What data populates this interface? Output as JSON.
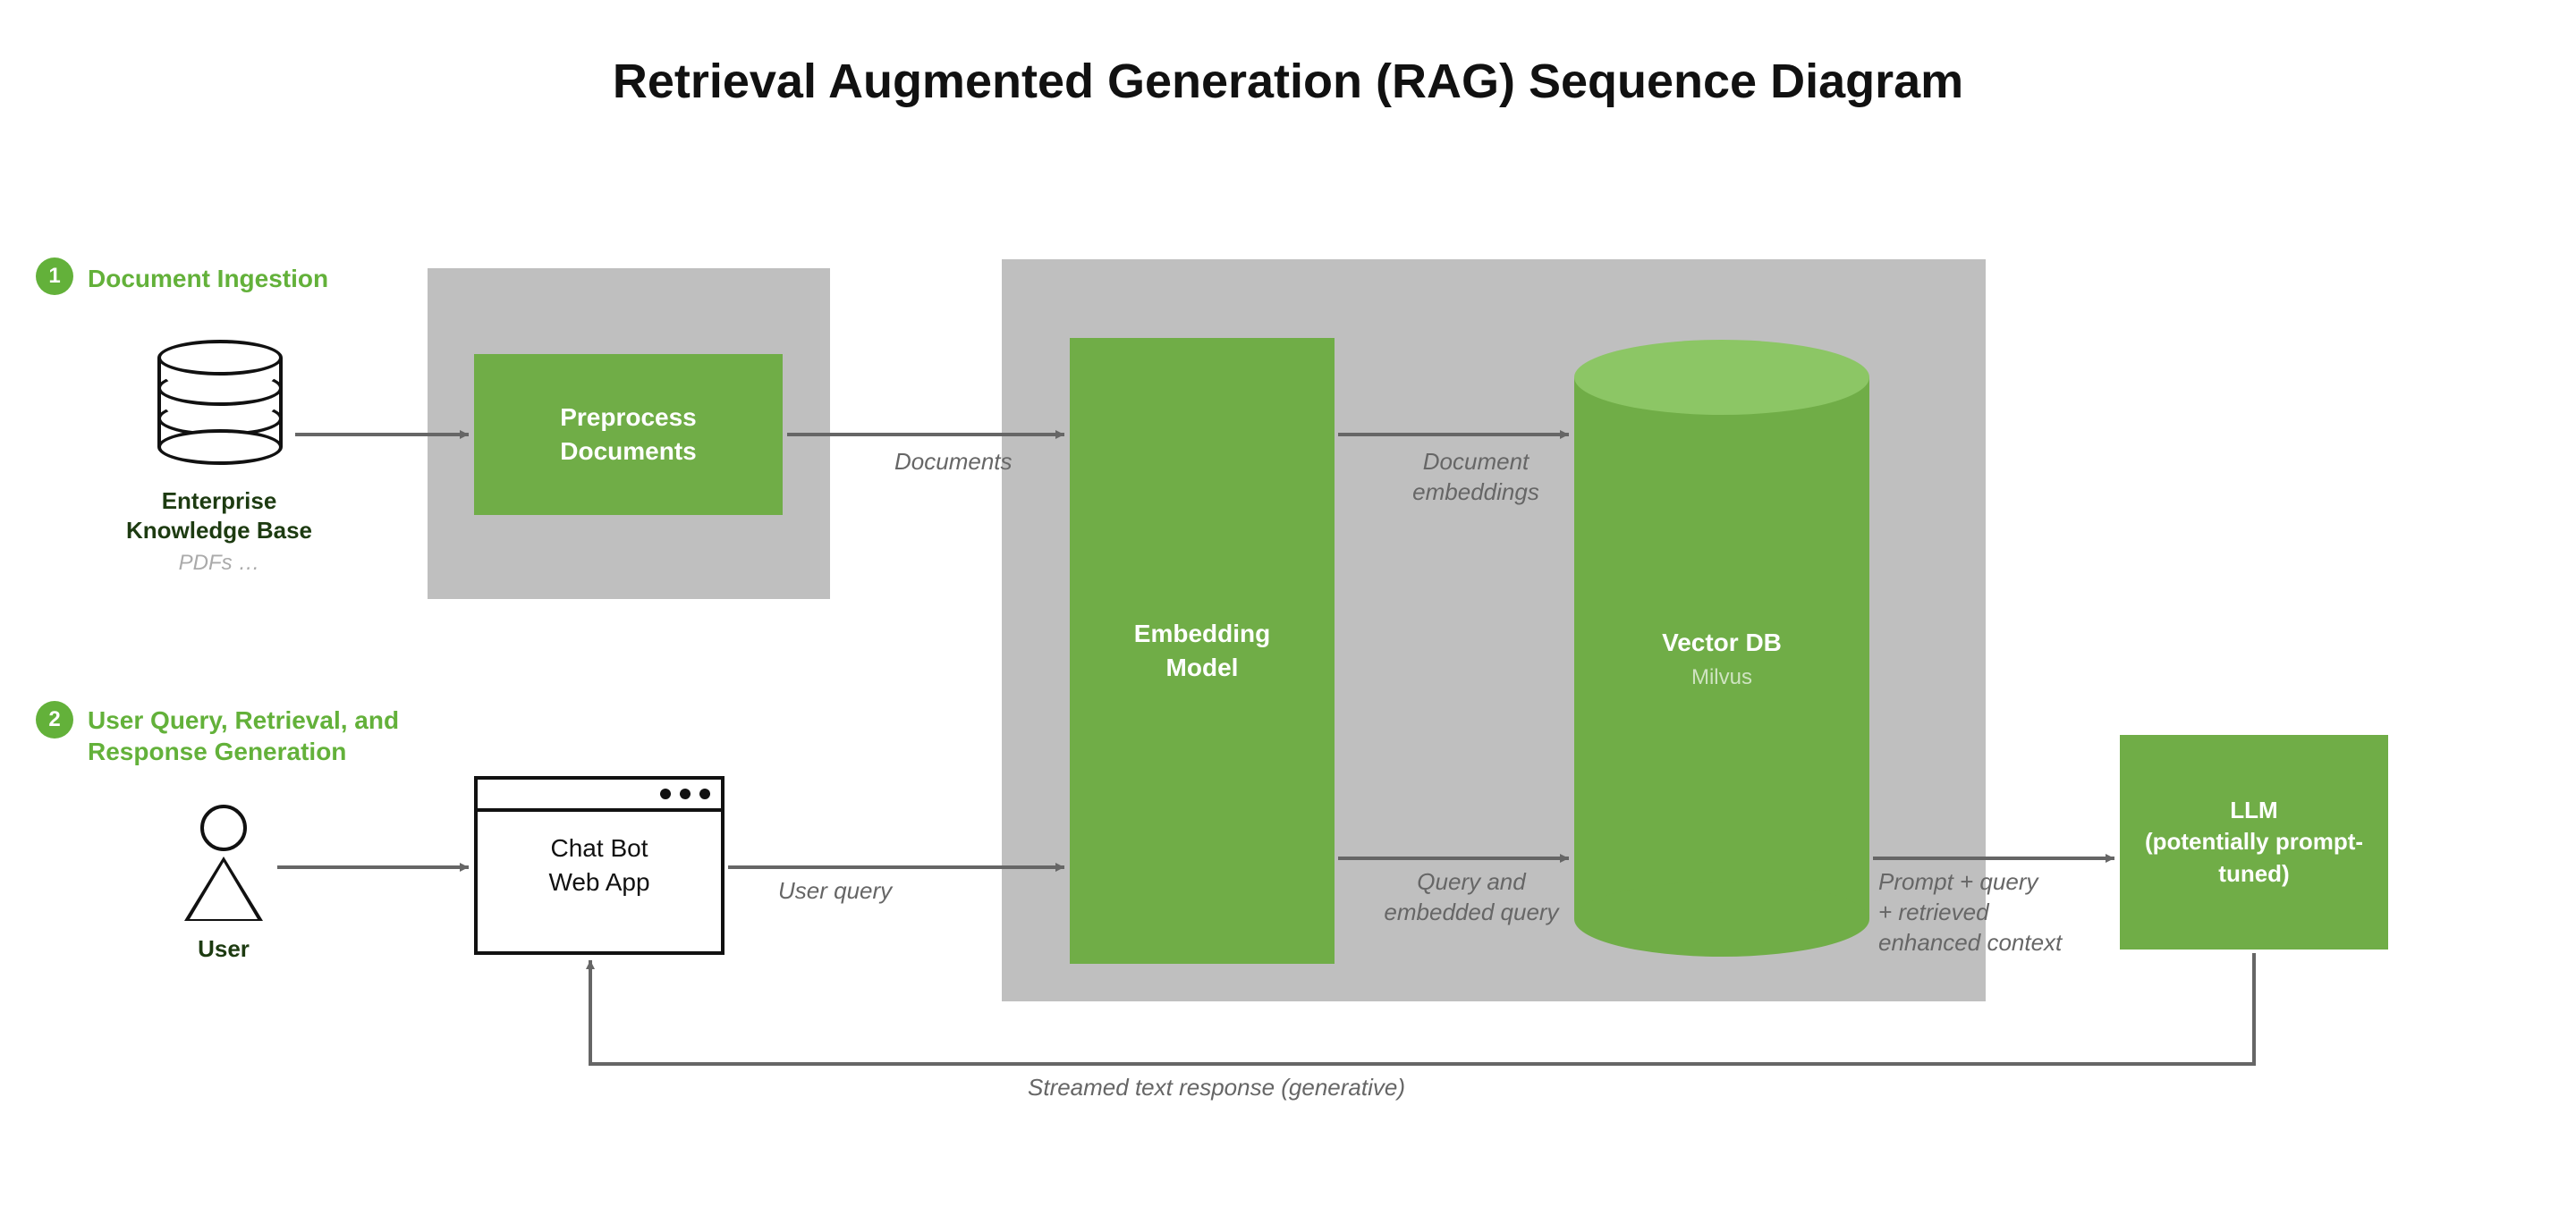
{
  "title": "Retrieval Augmented Generation (RAG) Sequence Diagram",
  "steps": {
    "one": {
      "num": "1",
      "label": "Document Ingestion"
    },
    "two": {
      "num": "2",
      "label": "User Query, Retrieval, and\nResponse Generation"
    }
  },
  "nodes": {
    "kb": {
      "title": "Enterprise\nKnowledge Base",
      "sub": "PDFs …"
    },
    "preprocess": {
      "label": "Preprocess\nDocuments"
    },
    "embedding": {
      "label": "Embedding\nModel"
    },
    "vectordb": {
      "label": "Vector DB",
      "sub": "Milvus"
    },
    "llm": {
      "label": "LLM\n(potentially prompt-\ntuned)"
    },
    "user": {
      "label": "User"
    },
    "app": {
      "label": "Chat Bot\nWeb App"
    }
  },
  "edges": {
    "documents": "Documents",
    "doc_embeddings": "Document\nembeddings",
    "user_query": "User query",
    "query_embedded": "Query and\nembedded query",
    "prompt_context": "Prompt + query\n+ retrieved\nenhanced context",
    "streamed": "Streamed text response (generative)"
  }
}
